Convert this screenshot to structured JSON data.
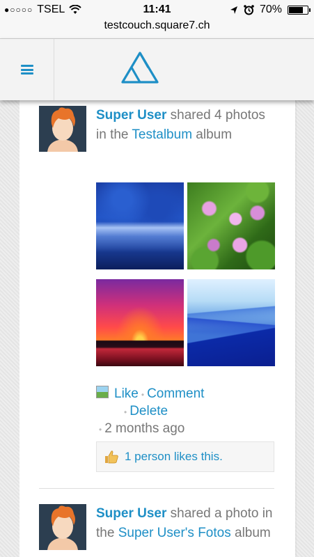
{
  "status_bar": {
    "signal": "●○○○○",
    "carrier": "TSEL",
    "time": "11:41",
    "battery_percent": "70%",
    "battery_level": 0.7
  },
  "browser": {
    "url": "testcouch.square7.ch"
  },
  "app": {
    "menu_icon": "hamburger-icon",
    "logo_icon": "triangle-logo"
  },
  "feed": {
    "post1": {
      "author": "Super User",
      "text_before": " shared 4 photos in the ",
      "album_link": "Testalbum",
      "text_after": " album",
      "photos": [
        "blue-forest",
        "pink-water-lilies",
        "red-sunset",
        "blue-mountains"
      ],
      "like": "Like",
      "comment": "Comment",
      "delete": "Delete",
      "time": "2 months ago",
      "likes_text": "1 person likes this."
    },
    "post2": {
      "author": "Super User",
      "text_before": " shared a photo in the ",
      "album_link": "Super User's Fotos",
      "text_after": " album"
    }
  },
  "colors": {
    "accent": "#1e8fc6",
    "text_gray": "#777777"
  }
}
